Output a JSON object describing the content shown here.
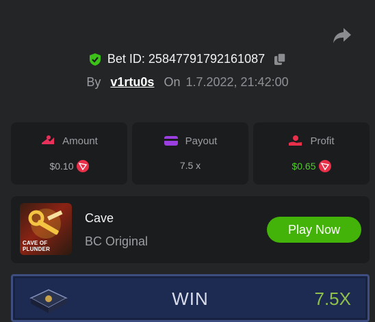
{
  "header": {
    "bet_label": "Bet ID:",
    "bet_id": "25847791792161087",
    "by_label": "By",
    "username": "v1rtu0s",
    "on_label": "On",
    "date": "1.7.2022, 21:42:00"
  },
  "stats": {
    "amount": {
      "label": "Amount",
      "value": "$0.10"
    },
    "payout": {
      "label": "Payout",
      "value": "7.5 x"
    },
    "profit": {
      "label": "Profit",
      "value": "$0.65"
    }
  },
  "game": {
    "thumb_caption": "CAVE OF PLUNDER",
    "name": "Cave",
    "subtitle": "BC Original",
    "play_label": "Play Now"
  },
  "result": {
    "label": "WIN",
    "multiplier": "7.5X"
  },
  "colors": {
    "accent_green": "#43b309",
    "profit_green": "#4fcd27",
    "tron_red": "#e8304a",
    "background": "#232527",
    "card": "#1a1c1e"
  },
  "icons": [
    "share-icon",
    "shield-check-icon",
    "copy-icon",
    "amount-icon",
    "payout-card-icon",
    "profit-hand-icon",
    "tron-coin-icon",
    "book-icon"
  ]
}
